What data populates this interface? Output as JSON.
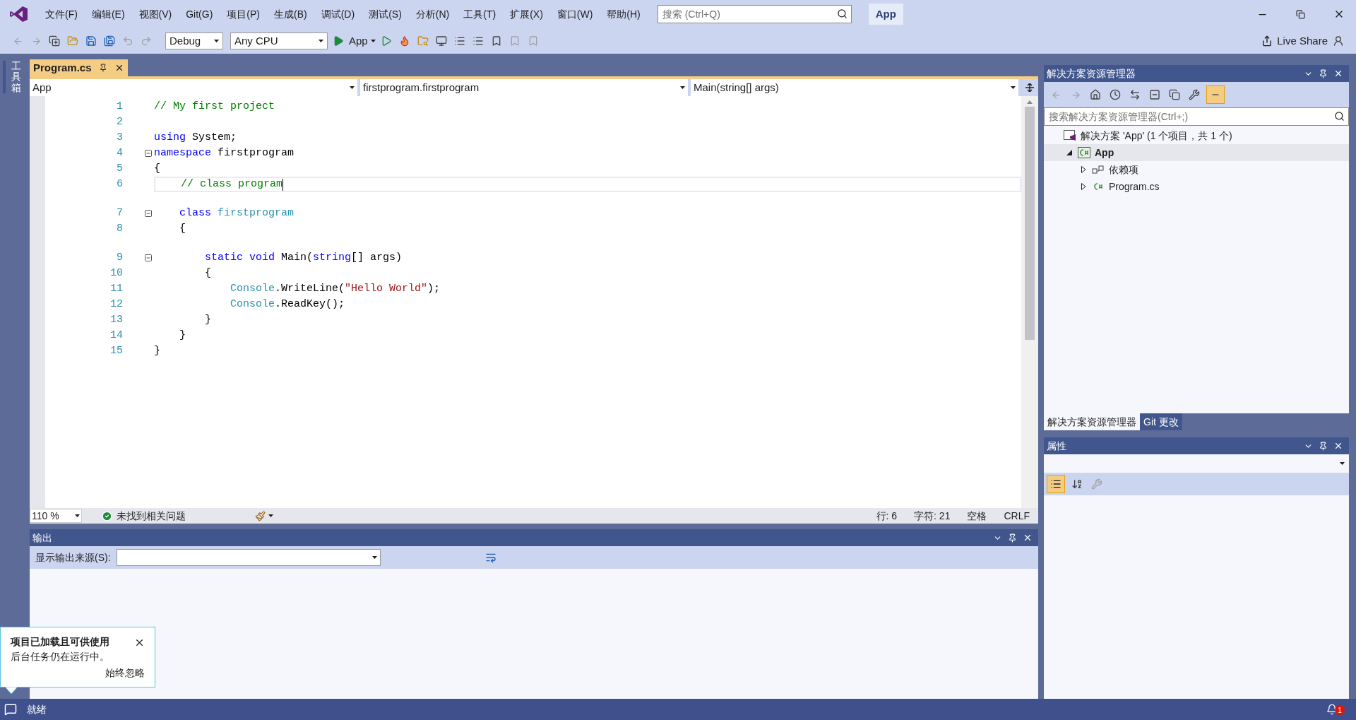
{
  "menu": [
    "文件(F)",
    "编辑(E)",
    "视图(V)",
    "Git(G)",
    "项目(P)",
    "生成(B)",
    "调试(D)",
    "测试(S)",
    "分析(N)",
    "工具(T)",
    "扩展(X)",
    "窗口(W)",
    "帮助(H)"
  ],
  "search": {
    "placeholder": "搜索 (Ctrl+Q)"
  },
  "solution_name": "App",
  "toolbar": {
    "configuration": "Debug",
    "platform": "Any CPU",
    "run_label": "App",
    "live_share": "Live Share"
  },
  "toolbox_tab": "工具箱",
  "editor": {
    "tabs": [
      {
        "label": "Program.cs",
        "selected": true
      }
    ],
    "nav": [
      "App",
      "firstprogram.firstprogram",
      "Main(string[] args)"
    ],
    "lines": [
      {
        "number": "1",
        "fold": false,
        "current": false,
        "gap_before": false,
        "tokens": [
          {
            "kind": "comment",
            "text": "// My first project"
          }
        ]
      },
      {
        "number": "2",
        "fold": false,
        "current": false,
        "gap_before": false
      },
      {
        "number": "3",
        "fold": false,
        "current": false,
        "gap_before": false,
        "tokens": [
          {
            "kind": "keyword",
            "text": "using"
          },
          {
            "kind": "plain",
            "text": " System;"
          }
        ]
      },
      {
        "number": "4",
        "fold": true,
        "current": false,
        "gap_before": false,
        "tokens": [
          {
            "kind": "keyword",
            "text": "namespace"
          },
          {
            "kind": "plain",
            "text": " firstprogram"
          }
        ]
      },
      {
        "number": "5",
        "fold": false,
        "current": false,
        "gap_before": false,
        "tokens": [
          {
            "kind": "plain",
            "text": "{"
          }
        ]
      },
      {
        "number": "6",
        "fold": false,
        "current": true,
        "gap_before": false,
        "tokens": [
          {
            "kind": "comment",
            "text": "    // class program"
          }
        ]
      },
      {
        "number": "7",
        "fold": true,
        "current": false,
        "gap_before": true,
        "tokens": [
          {
            "kind": "keyword",
            "text": "    class"
          },
          {
            "kind": "type",
            "text": " firstprogram"
          }
        ]
      },
      {
        "number": "8",
        "fold": false,
        "current": false,
        "gap_before": false,
        "tokens": [
          {
            "kind": "plain",
            "text": "    {"
          }
        ]
      },
      {
        "number": "9",
        "fold": true,
        "current": false,
        "gap_before": true,
        "tokens": [
          {
            "kind": "keyword",
            "text": "        static void"
          },
          {
            "kind": "plain",
            "text": " Main("
          },
          {
            "kind": "keyword",
            "text": "string"
          },
          {
            "kind": "plain",
            "text": "[] args)"
          }
        ]
      },
      {
        "number": "10",
        "fold": false,
        "current": false,
        "gap_before": false,
        "tokens": [
          {
            "kind": "plain",
            "text": "        {"
          }
        ]
      },
      {
        "number": "11",
        "fold": false,
        "current": false,
        "gap_before": false,
        "tokens": [
          {
            "kind": "type",
            "text": "            Console"
          },
          {
            "kind": "plain",
            "text": ".WriteLine("
          },
          {
            "kind": "string",
            "text": "\"Hello World\""
          },
          {
            "kind": "plain",
            "text": ");"
          }
        ]
      },
      {
        "number": "12",
        "fold": false,
        "current": false,
        "gap_before": false,
        "tokens": [
          {
            "kind": "type",
            "text": "            Console"
          },
          {
            "kind": "plain",
            "text": ".ReadKey();"
          }
        ]
      },
      {
        "number": "13",
        "fold": false,
        "current": false,
        "gap_before": false,
        "tokens": [
          {
            "kind": "plain",
            "text": "        }"
          }
        ]
      },
      {
        "number": "14",
        "fold": false,
        "current": false,
        "gap_before": false,
        "tokens": [
          {
            "kind": "plain",
            "text": "    }"
          }
        ]
      },
      {
        "number": "15",
        "fold": false,
        "current": false,
        "gap_before": false,
        "tokens": [
          {
            "kind": "plain",
            "text": "}"
          }
        ]
      }
    ],
    "zoom": "110 %",
    "issues": "未找到相关问题",
    "position": [
      "行: 6",
      "字符: 21",
      "空格",
      "CRLF"
    ]
  },
  "output": {
    "title": "输出",
    "source_label": "显示输出来源(S):"
  },
  "solution_explorer": {
    "title": "解决方案资源管理器",
    "search": {
      "placeholder": "搜索解决方案资源管理器(Ctrl+;)"
    },
    "tree": [
      {
        "label": "解决方案 'App' (1 个项目，共 1 个)",
        "kind": "solution",
        "children": [
          {
            "label": "App",
            "kind": "project",
            "expanded": true,
            "selected": true,
            "children": [
              {
                "label": "依赖项",
                "kind": "dependencies",
                "expanded": false,
                "selected": false
              },
              {
                "label": "Program.cs",
                "kind": "csharp",
                "expanded": false,
                "selected": false
              }
            ]
          }
        ]
      }
    ],
    "tabs": [
      {
        "label": "解决方案资源管理器",
        "selected": true
      },
      {
        "label": "Git 更改",
        "selected": false
      }
    ]
  },
  "properties": {
    "title": "属性"
  },
  "notification": {
    "title": "项目已加载且可供使用",
    "message": "后台任务仍在运行中。",
    "action": "始终忽略"
  },
  "status_bar": {
    "text": "就绪",
    "badge": "1"
  }
}
